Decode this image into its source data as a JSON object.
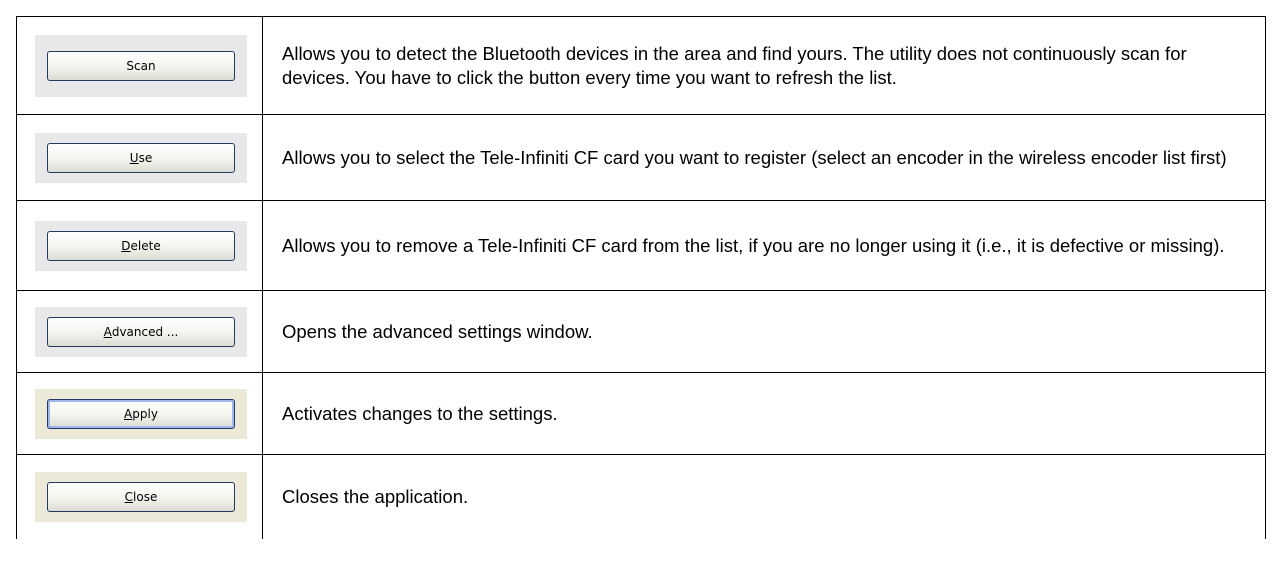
{
  "rows": [
    {
      "button": {
        "prefix": "",
        "mnemonic": "",
        "rest": "Scan"
      },
      "description": "Allows you to detect the Bluetooth devices in the area and find yours. The utility does not continuously scan for devices. You have to click the button every time you want to refresh the list."
    },
    {
      "button": {
        "prefix": "",
        "mnemonic": "U",
        "rest": "se"
      },
      "description": "Allows you to select the Tele-Infiniti CF card you want to register (select an encoder in the wireless encoder list first)"
    },
    {
      "button": {
        "prefix": "",
        "mnemonic": "D",
        "rest": "elete"
      },
      "description": "Allows you to remove a Tele-Infiniti CF card from the list, if you are no longer using it (i.e., it is defective or missing)."
    },
    {
      "button": {
        "prefix": "",
        "mnemonic": "A",
        "rest": "dvanced ..."
      },
      "description": "Opens the advanced settings window."
    },
    {
      "button": {
        "prefix": "",
        "mnemonic": "A",
        "rest": "pply"
      },
      "description": "Activates changes to the settings."
    },
    {
      "button": {
        "prefix": "",
        "mnemonic": "C",
        "rest": "lose"
      },
      "description": "Closes the application."
    }
  ]
}
